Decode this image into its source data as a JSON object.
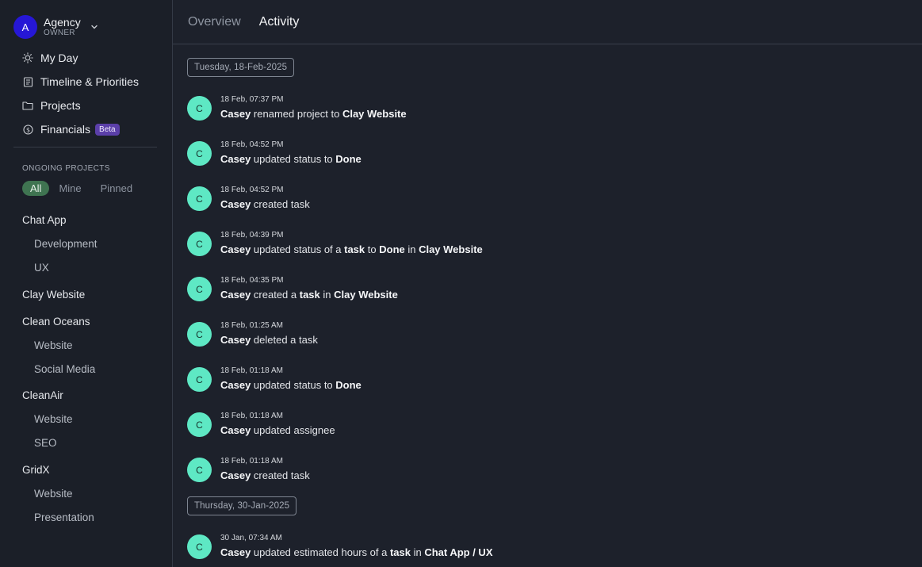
{
  "workspace": {
    "initial": "A",
    "name": "Agency",
    "role": "OWNER",
    "avatar_color": "#2617d6"
  },
  "nav": [
    {
      "label": "My Day",
      "icon": "sun-icon"
    },
    {
      "label": "Timeline & Priorities",
      "icon": "timeline-icon"
    },
    {
      "label": "Projects",
      "icon": "folder-icon"
    },
    {
      "label": "Financials",
      "icon": "dollar-icon",
      "badge": "Beta"
    }
  ],
  "ongoing": {
    "title": "ONGOING PROJECTS",
    "filters": [
      "All",
      "Mine",
      "Pinned"
    ],
    "active_filter": "All",
    "projects": [
      {
        "name": "Chat App",
        "subs": [
          "Development",
          "UX"
        ]
      },
      {
        "name": "Clay Website",
        "subs": []
      },
      {
        "name": "Clean Oceans",
        "subs": [
          "Website",
          "Social Media"
        ]
      },
      {
        "name": "CleanAir",
        "subs": [
          "Website",
          "SEO"
        ]
      },
      {
        "name": "GridX",
        "subs": [
          "Website",
          "Presentation"
        ]
      }
    ]
  },
  "tabs": [
    {
      "label": "Overview",
      "active": false
    },
    {
      "label": "Activity",
      "active": true
    }
  ],
  "activity": {
    "avatar_color": "#5ee8c4",
    "groups": [
      {
        "date": "Tuesday, 18-Feb-2025",
        "entries": [
          {
            "initial": "C",
            "time": "18 Feb, 07:37 PM",
            "parts": [
              [
                "b",
                "Casey"
              ],
              [
                "t",
                " renamed project to "
              ],
              [
                "b",
                "Clay Website"
              ]
            ]
          },
          {
            "initial": "C",
            "time": "18 Feb, 04:52 PM",
            "parts": [
              [
                "b",
                "Casey"
              ],
              [
                "t",
                " updated status to "
              ],
              [
                "b",
                "Done"
              ]
            ]
          },
          {
            "initial": "C",
            "time": "18 Feb, 04:52 PM",
            "parts": [
              [
                "b",
                "Casey"
              ],
              [
                "t",
                " created task"
              ]
            ]
          },
          {
            "initial": "C",
            "time": "18 Feb, 04:39 PM",
            "parts": [
              [
                "b",
                "Casey"
              ],
              [
                "t",
                " updated status of a "
              ],
              [
                "b",
                "task"
              ],
              [
                "t",
                " to "
              ],
              [
                "b",
                "Done"
              ],
              [
                "t",
                " in "
              ],
              [
                "b",
                "Clay Website"
              ]
            ]
          },
          {
            "initial": "C",
            "time": "18 Feb, 04:35 PM",
            "parts": [
              [
                "b",
                "Casey"
              ],
              [
                "t",
                " created a "
              ],
              [
                "b",
                "task"
              ],
              [
                "t",
                " in "
              ],
              [
                "b",
                "Clay Website"
              ]
            ]
          },
          {
            "initial": "C",
            "time": "18 Feb, 01:25 AM",
            "parts": [
              [
                "b",
                "Casey"
              ],
              [
                "t",
                " deleted a task"
              ]
            ]
          },
          {
            "initial": "C",
            "time": "18 Feb, 01:18 AM",
            "parts": [
              [
                "b",
                "Casey"
              ],
              [
                "t",
                " updated status to "
              ],
              [
                "b",
                "Done"
              ]
            ]
          },
          {
            "initial": "C",
            "time": "18 Feb, 01:18 AM",
            "parts": [
              [
                "b",
                "Casey"
              ],
              [
                "t",
                " updated assignee"
              ]
            ]
          },
          {
            "initial": "C",
            "time": "18 Feb, 01:18 AM",
            "parts": [
              [
                "b",
                "Casey"
              ],
              [
                "t",
                " created task"
              ]
            ]
          }
        ]
      },
      {
        "date": "Thursday, 30-Jan-2025",
        "entries": [
          {
            "initial": "C",
            "time": "30 Jan, 07:34 AM",
            "parts": [
              [
                "b",
                "Casey"
              ],
              [
                "t",
                " updated estimated hours of a "
              ],
              [
                "b",
                "task"
              ],
              [
                "t",
                " in "
              ],
              [
                "b",
                "Chat App / UX"
              ]
            ]
          }
        ]
      }
    ]
  }
}
